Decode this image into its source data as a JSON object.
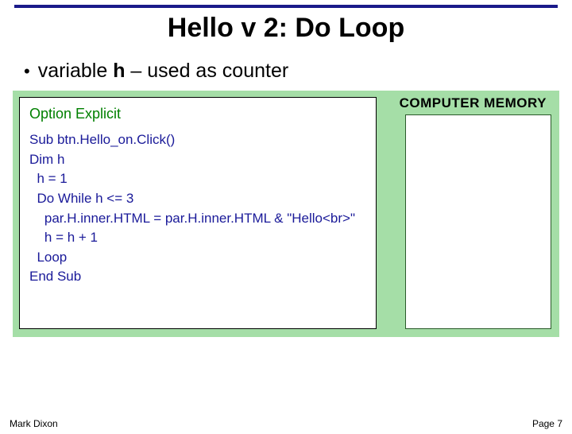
{
  "title": "Hello v 2: Do Loop",
  "bullet": {
    "prefix": "variable ",
    "var": "h",
    "suffix": " – used as counter"
  },
  "code": {
    "option": "Option Explicit",
    "lines": [
      "Sub btn.Hello_on.Click()",
      "Dim h",
      "  h = 1",
      "  Do While h <= 3",
      "    par.H.inner.HTML = par.H.inner.HTML & \"Hello<br>\"",
      "    h = h + 1",
      "  Loop",
      "End Sub"
    ]
  },
  "memory_label": "COMPUTER MEMORY",
  "footer": {
    "author": "Mark Dixon",
    "page": "Page 7"
  }
}
